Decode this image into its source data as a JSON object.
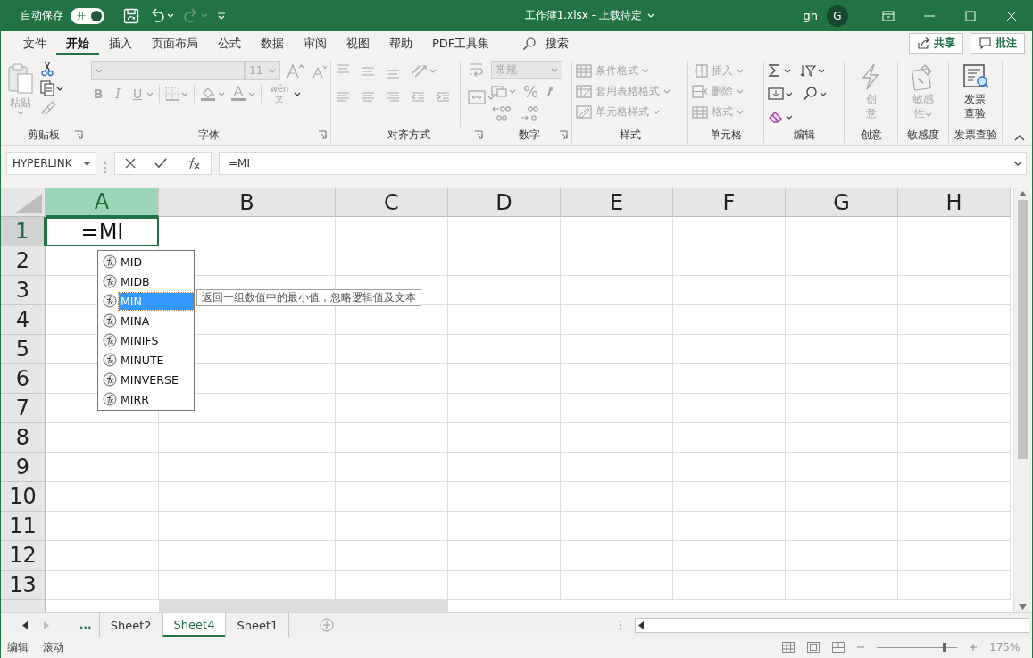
{
  "title_bar": {
    "autosave_label": "自动保存",
    "autosave": {
      "on": true,
      "label": "开"
    },
    "quick_access": [
      {
        "kind": "save",
        "disabled": false
      },
      {
        "kind": "undo",
        "disabled": false
      },
      {
        "kind": "redo",
        "disabled": true
      },
      {
        "kind": "customize",
        "disabled": false
      }
    ],
    "title": "工作簿1.xlsx - 上载待定",
    "user": "gh",
    "avatar": "G"
  },
  "ribbon_tabs": [
    {
      "label": "文件",
      "selected": false
    },
    {
      "label": "开始",
      "selected": true
    },
    {
      "label": "插入",
      "selected": false
    },
    {
      "label": "页面布局",
      "selected": false
    },
    {
      "label": "公式",
      "selected": false
    },
    {
      "label": "数据",
      "selected": false
    },
    {
      "label": "审阅",
      "selected": false
    },
    {
      "label": "视图",
      "selected": false
    },
    {
      "label": "帮助",
      "selected": false
    },
    {
      "label": "PDF工具集",
      "selected": false
    }
  ],
  "search": {
    "label": "搜索"
  },
  "actions": [
    {
      "kind": "share",
      "label": "共享"
    },
    {
      "kind": "comments",
      "label": "批注"
    }
  ],
  "ribbon_groups": [
    {
      "kind": "clipboard",
      "label": "剪贴板",
      "launcher": true,
      "disabled": false,
      "paste": {
        "label": "粘贴",
        "disabled": true
      }
    },
    {
      "kind": "font",
      "label": "字体",
      "launcher": true,
      "disabled": true,
      "font_size": "11",
      "bold": "B",
      "italic": "I",
      "underline": "U",
      "phonetic": "wén 文"
    },
    {
      "kind": "alignment",
      "label": "对齐方式",
      "launcher": true,
      "disabled": true
    },
    {
      "kind": "number",
      "label": "数字",
      "launcher": true,
      "disabled": true,
      "format": "常规",
      "percent": "%"
    },
    {
      "kind": "styles",
      "label": "样式",
      "launcher": false,
      "disabled": true,
      "items": [
        "条件格式",
        "套用表格格式",
        "单元格样式"
      ]
    },
    {
      "kind": "cells",
      "label": "单元格",
      "launcher": false,
      "disabled": true,
      "items": [
        "插入",
        "删除",
        "格式"
      ]
    },
    {
      "kind": "editing",
      "label": "编辑",
      "launcher": false,
      "disabled": false
    },
    {
      "kind": "ideas",
      "label": "创意",
      "launcher": false,
      "disabled": true,
      "button": "创意"
    },
    {
      "kind": "sensitivity",
      "label": "敏感度",
      "launcher": false,
      "disabled": true,
      "button": "敏感性"
    },
    {
      "kind": "invoice",
      "label": "发票查验",
      "launcher": false,
      "disabled": false,
      "button": "发票查验"
    }
  ],
  "formula_bar": {
    "name_box": "HYPERLINK",
    "formula": "=MI"
  },
  "sheet": {
    "columns": [
      {
        "label": "A",
        "selected": true
      },
      {
        "label": "B",
        "selected": false
      },
      {
        "label": "C",
        "selected": false
      },
      {
        "label": "D",
        "selected": false
      },
      {
        "label": "E",
        "selected": false
      },
      {
        "label": "F",
        "selected": false
      },
      {
        "label": "G",
        "selected": false
      },
      {
        "label": "H",
        "selected": false
      }
    ],
    "rows": [
      {
        "label": "1",
        "selected": true
      },
      {
        "label": "2",
        "selected": false
      },
      {
        "label": "3",
        "selected": false
      },
      {
        "label": "4",
        "selected": false
      },
      {
        "label": "5",
        "selected": false
      },
      {
        "label": "6",
        "selected": false
      },
      {
        "label": "7",
        "selected": false
      },
      {
        "label": "8",
        "selected": false
      },
      {
        "label": "9",
        "selected": false
      },
      {
        "label": "10",
        "selected": false
      },
      {
        "label": "11",
        "selected": false
      },
      {
        "label": "12",
        "selected": false
      },
      {
        "label": "13",
        "selected": false
      }
    ],
    "active_cell": {
      "value": "=MI"
    },
    "autocomplete": {
      "items": [
        {
          "label": "MID",
          "selected": false
        },
        {
          "label": "MIDB",
          "selected": false
        },
        {
          "label": "MIN",
          "selected": true
        },
        {
          "label": "MINA",
          "selected": false
        },
        {
          "label": "MINIFS",
          "selected": false
        },
        {
          "label": "MINUTE",
          "selected": false
        },
        {
          "label": "MINVERSE",
          "selected": false
        },
        {
          "label": "MIRR",
          "selected": false
        }
      ],
      "tooltip": "返回一组数值中的最小值，忽略逻辑值及文本"
    }
  },
  "sheet_tabs": {
    "overflow": "...",
    "tabs": [
      {
        "label": "Sheet2",
        "selected": false
      },
      {
        "label": "Sheet4",
        "selected": true
      },
      {
        "label": "Sheet1",
        "selected": false
      }
    ]
  },
  "status_bar": {
    "items": [
      "编辑",
      "滚动"
    ],
    "zoom": {
      "level": 0.83,
      "label": "175%"
    }
  }
}
